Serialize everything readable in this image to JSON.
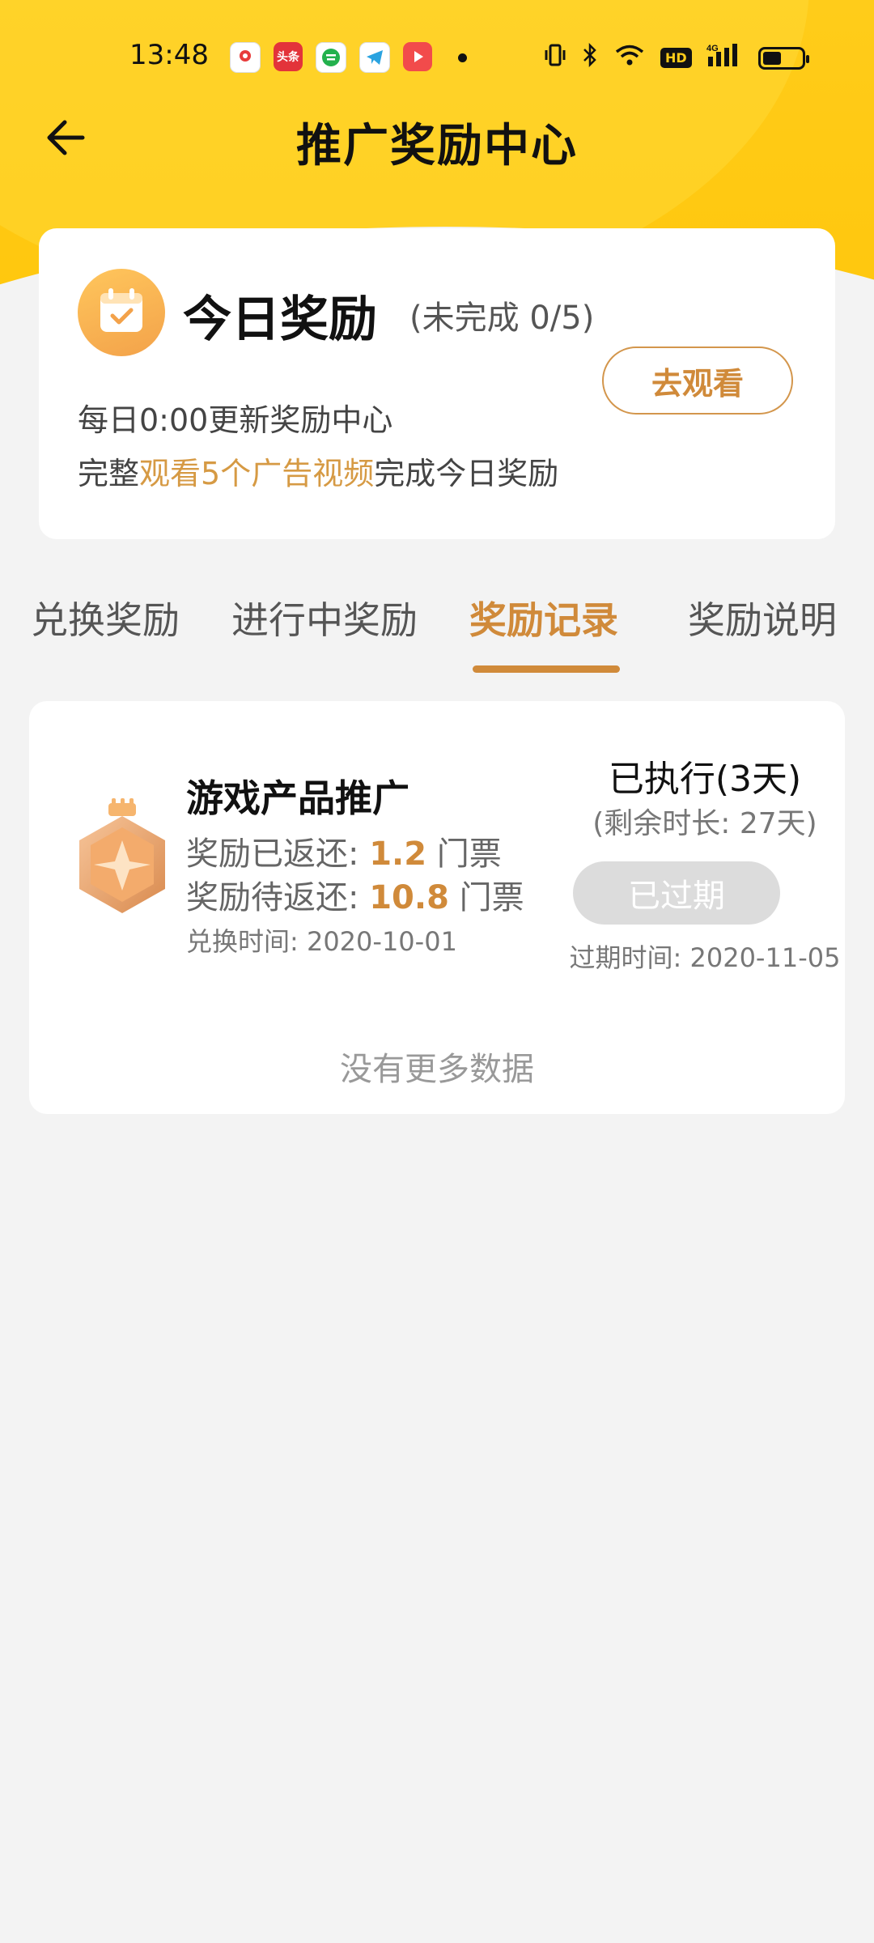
{
  "status_bar": {
    "time": "13:48",
    "apps": [
      {
        "name": "app-red-map",
        "color": "#e83b3b",
        "label": ""
      },
      {
        "name": "app-toutiao",
        "color": "#e3333a",
        "label": "头条"
      },
      {
        "name": "app-green",
        "color": "#23b14d",
        "label": ""
      },
      {
        "name": "app-telegram",
        "color": "#2aa3e0",
        "label": ""
      },
      {
        "name": "app-video",
        "color": "#f24b4b",
        "label": ""
      }
    ],
    "network": "4G",
    "hd": "HD"
  },
  "header": {
    "title": "推广奖励中心"
  },
  "today_card": {
    "title": "今日奖励",
    "progress": "(未完成 0/5)",
    "watch_button": "去观看",
    "line1": "每日0:00更新奖励中心",
    "line2_prefix": "完整",
    "line2_highlight": "观看5个广告视频",
    "line2_suffix": "完成今日奖励"
  },
  "tabs": [
    {
      "label": "兑换奖励",
      "active": false
    },
    {
      "label": "进行中奖励",
      "active": false
    },
    {
      "label": "奖励记录",
      "active": true
    },
    {
      "label": "奖励说明",
      "active": false
    }
  ],
  "record": {
    "title": "游戏产品推广",
    "returned_label": "奖励已返还:",
    "returned_amount": "1.2",
    "pending_label": "奖励待返还:",
    "pending_amount": "10.8",
    "unit": "门票",
    "exchange_time": "兑换时间: 2020-10-01",
    "status": "已执行(3天)",
    "remaining": "(剩余时长:  27天)",
    "expired_button": "已过期",
    "expire_time": "过期时间: 2020-11-05"
  },
  "footer_text": "没有更多数据",
  "colors": {
    "header_yellow": "#ffc60a",
    "accent_orange": "#d08a3a",
    "expired_gray": "#dcdcdc"
  }
}
